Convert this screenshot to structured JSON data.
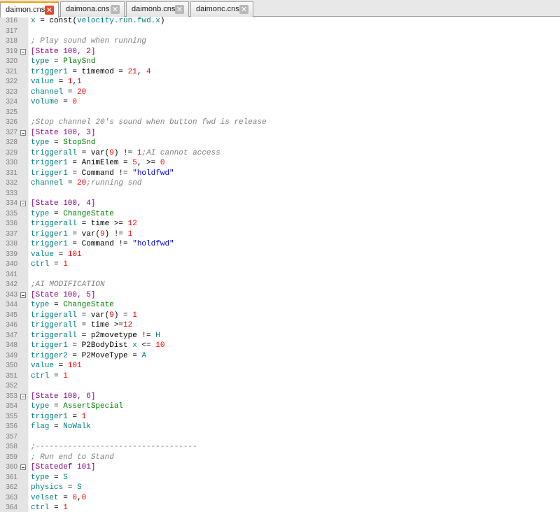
{
  "tabs": [
    {
      "label": "daimon.cns",
      "active": true
    },
    {
      "label": "daimona.cns",
      "active": false
    },
    {
      "label": "daimonb.cns",
      "active": false
    },
    {
      "label": "daimonc.cns",
      "active": false
    }
  ],
  "colors": {
    "comment": "#808080",
    "section": "#880088",
    "identifier": "#008080",
    "number": "#ff0000",
    "type_value": "#008000",
    "string": "#0000ff",
    "active_tab_close": "#e04a2a"
  },
  "lines": [
    {
      "n": "316",
      "fold": false,
      "tokens": [
        [
          "i",
          "x"
        ],
        [
          "p",
          " = "
        ],
        [
          "p",
          "const"
        ],
        [
          "p",
          "("
        ],
        [
          "i",
          "velocity.run.fwd.x"
        ],
        [
          "p",
          ")"
        ]
      ]
    },
    {
      "n": "317",
      "fold": false,
      "tokens": []
    },
    {
      "n": "318",
      "fold": false,
      "tokens": [
        [
          "c",
          "; Play sound when running"
        ]
      ]
    },
    {
      "n": "319",
      "fold": true,
      "tokens": [
        [
          "s",
          "[State 100, 2]"
        ]
      ]
    },
    {
      "n": "320",
      "fold": false,
      "tokens": [
        [
          "i",
          "type"
        ],
        [
          "p",
          " = "
        ],
        [
          "t",
          "PlaySnd"
        ]
      ]
    },
    {
      "n": "321",
      "fold": false,
      "tokens": [
        [
          "i",
          "trigger1"
        ],
        [
          "p",
          " = timemod = "
        ],
        [
          "n",
          "21"
        ],
        [
          "p",
          ", "
        ],
        [
          "n",
          "4"
        ]
      ]
    },
    {
      "n": "322",
      "fold": false,
      "tokens": [
        [
          "i",
          "value"
        ],
        [
          "p",
          " = "
        ],
        [
          "n",
          "1"
        ],
        [
          "p",
          ","
        ],
        [
          "n",
          "1"
        ]
      ]
    },
    {
      "n": "323",
      "fold": false,
      "tokens": [
        [
          "i",
          "channel"
        ],
        [
          "p",
          " = "
        ],
        [
          "n",
          "20"
        ]
      ]
    },
    {
      "n": "324",
      "fold": false,
      "tokens": [
        [
          "i",
          "volume"
        ],
        [
          "p",
          " = "
        ],
        [
          "n",
          "0"
        ]
      ]
    },
    {
      "n": "325",
      "fold": false,
      "tokens": []
    },
    {
      "n": "326",
      "fold": false,
      "tokens": [
        [
          "c",
          ";Stop channel 20's sound when button fwd is release"
        ]
      ]
    },
    {
      "n": "327",
      "fold": true,
      "tokens": [
        [
          "s",
          "[State 100, 3]"
        ]
      ]
    },
    {
      "n": "328",
      "fold": false,
      "tokens": [
        [
          "i",
          "type"
        ],
        [
          "p",
          " = "
        ],
        [
          "t",
          "StopSnd"
        ]
      ]
    },
    {
      "n": "329",
      "fold": false,
      "tokens": [
        [
          "i",
          "triggerall"
        ],
        [
          "p",
          " = var("
        ],
        [
          "n",
          "9"
        ],
        [
          "p",
          ") != "
        ],
        [
          "n",
          "1"
        ],
        [
          "c",
          ";AI cannot access"
        ]
      ]
    },
    {
      "n": "330",
      "fold": false,
      "tokens": [
        [
          "i",
          "trigger1"
        ],
        [
          "p",
          " = AnimElem = "
        ],
        [
          "n",
          "5"
        ],
        [
          "p",
          ", >= "
        ],
        [
          "n",
          "0"
        ]
      ]
    },
    {
      "n": "331",
      "fold": false,
      "tokens": [
        [
          "i",
          "trigger1"
        ],
        [
          "p",
          " = Command != "
        ],
        [
          "q",
          "\"holdfwd\""
        ]
      ]
    },
    {
      "n": "332",
      "fold": false,
      "tokens": [
        [
          "i",
          "channel"
        ],
        [
          "p",
          " = "
        ],
        [
          "n",
          "20"
        ],
        [
          "c",
          ";running snd"
        ]
      ]
    },
    {
      "n": "333",
      "fold": false,
      "tokens": []
    },
    {
      "n": "334",
      "fold": true,
      "tokens": [
        [
          "s",
          "[State 100, 4]"
        ]
      ]
    },
    {
      "n": "335",
      "fold": false,
      "tokens": [
        [
          "i",
          "type"
        ],
        [
          "p",
          " = "
        ],
        [
          "t",
          "ChangeState"
        ]
      ]
    },
    {
      "n": "336",
      "fold": false,
      "tokens": [
        [
          "i",
          "triggerall"
        ],
        [
          "p",
          " = time >= "
        ],
        [
          "n",
          "12"
        ]
      ]
    },
    {
      "n": "337",
      "fold": false,
      "tokens": [
        [
          "i",
          "trigger1"
        ],
        [
          "p",
          " = var("
        ],
        [
          "n",
          "9"
        ],
        [
          "p",
          ") != "
        ],
        [
          "n",
          "1"
        ]
      ]
    },
    {
      "n": "338",
      "fold": false,
      "tokens": [
        [
          "i",
          "trigger1"
        ],
        [
          "p",
          " = Command != "
        ],
        [
          "q",
          "\"holdfwd\""
        ]
      ]
    },
    {
      "n": "339",
      "fold": false,
      "tokens": [
        [
          "i",
          "value"
        ],
        [
          "p",
          " = "
        ],
        [
          "n",
          "101"
        ]
      ]
    },
    {
      "n": "340",
      "fold": false,
      "tokens": [
        [
          "i",
          "ctrl"
        ],
        [
          "p",
          " = "
        ],
        [
          "n",
          "1"
        ]
      ]
    },
    {
      "n": "341",
      "fold": false,
      "tokens": []
    },
    {
      "n": "342",
      "fold": false,
      "tokens": [
        [
          "c",
          ";AI MODIFICATION"
        ]
      ]
    },
    {
      "n": "343",
      "fold": true,
      "tokens": [
        [
          "s",
          "[State 100, 5]"
        ]
      ]
    },
    {
      "n": "344",
      "fold": false,
      "tokens": [
        [
          "i",
          "type"
        ],
        [
          "p",
          " = "
        ],
        [
          "t",
          "ChangeState"
        ]
      ]
    },
    {
      "n": "345",
      "fold": false,
      "tokens": [
        [
          "i",
          "triggerall"
        ],
        [
          "p",
          " = var("
        ],
        [
          "n",
          "9"
        ],
        [
          "p",
          ") = "
        ],
        [
          "n",
          "1"
        ]
      ]
    },
    {
      "n": "346",
      "fold": false,
      "tokens": [
        [
          "i",
          "triggerall"
        ],
        [
          "p",
          " = time >="
        ],
        [
          "n",
          "12"
        ]
      ]
    },
    {
      "n": "347",
      "fold": false,
      "tokens": [
        [
          "i",
          "triggerall"
        ],
        [
          "p",
          " = p2movetype != "
        ],
        [
          "i",
          "H"
        ]
      ]
    },
    {
      "n": "348",
      "fold": false,
      "tokens": [
        [
          "i",
          "trigger1"
        ],
        [
          "p",
          " = P2BodyDist "
        ],
        [
          "i",
          "x"
        ],
        [
          "p",
          " <= "
        ],
        [
          "n",
          "10"
        ]
      ]
    },
    {
      "n": "349",
      "fold": false,
      "tokens": [
        [
          "i",
          "trigger2"
        ],
        [
          "p",
          " = P2MoveType = "
        ],
        [
          "i",
          "A"
        ]
      ]
    },
    {
      "n": "350",
      "fold": false,
      "tokens": [
        [
          "i",
          "value"
        ],
        [
          "p",
          " = "
        ],
        [
          "n",
          "101"
        ]
      ]
    },
    {
      "n": "351",
      "fold": false,
      "tokens": [
        [
          "i",
          "ctrl"
        ],
        [
          "p",
          " = "
        ],
        [
          "n",
          "1"
        ]
      ]
    },
    {
      "n": "352",
      "fold": false,
      "tokens": []
    },
    {
      "n": "353",
      "fold": true,
      "tokens": [
        [
          "s",
          "[State 100, 6]"
        ]
      ]
    },
    {
      "n": "354",
      "fold": false,
      "tokens": [
        [
          "i",
          "type"
        ],
        [
          "p",
          " = "
        ],
        [
          "t",
          "AssertSpecial"
        ]
      ]
    },
    {
      "n": "355",
      "fold": false,
      "tokens": [
        [
          "i",
          "trigger1"
        ],
        [
          "p",
          " = "
        ],
        [
          "n",
          "1"
        ]
      ]
    },
    {
      "n": "356",
      "fold": false,
      "tokens": [
        [
          "i",
          "flag"
        ],
        [
          "p",
          " = "
        ],
        [
          "i",
          "NoWalk"
        ]
      ]
    },
    {
      "n": "357",
      "fold": false,
      "tokens": []
    },
    {
      "n": "358",
      "fold": false,
      "tokens": [
        [
          "c",
          ";-----------------------------------"
        ]
      ]
    },
    {
      "n": "359",
      "fold": false,
      "tokens": [
        [
          "c",
          "; Run end to Stand"
        ]
      ]
    },
    {
      "n": "360",
      "fold": true,
      "tokens": [
        [
          "s",
          "[Statedef 101]"
        ]
      ]
    },
    {
      "n": "361",
      "fold": false,
      "tokens": [
        [
          "i",
          "type"
        ],
        [
          "p",
          " = "
        ],
        [
          "i",
          "S"
        ]
      ]
    },
    {
      "n": "362",
      "fold": false,
      "tokens": [
        [
          "i",
          "physics"
        ],
        [
          "p",
          " = "
        ],
        [
          "i",
          "S"
        ]
      ]
    },
    {
      "n": "363",
      "fold": false,
      "tokens": [
        [
          "i",
          "velset"
        ],
        [
          "p",
          " = "
        ],
        [
          "n",
          "0"
        ],
        [
          "p",
          ","
        ],
        [
          "n",
          "0"
        ]
      ]
    },
    {
      "n": "364",
      "fold": false,
      "tokens": [
        [
          "i",
          "ctrl"
        ],
        [
          "p",
          " = "
        ],
        [
          "n",
          "1"
        ]
      ]
    }
  ]
}
